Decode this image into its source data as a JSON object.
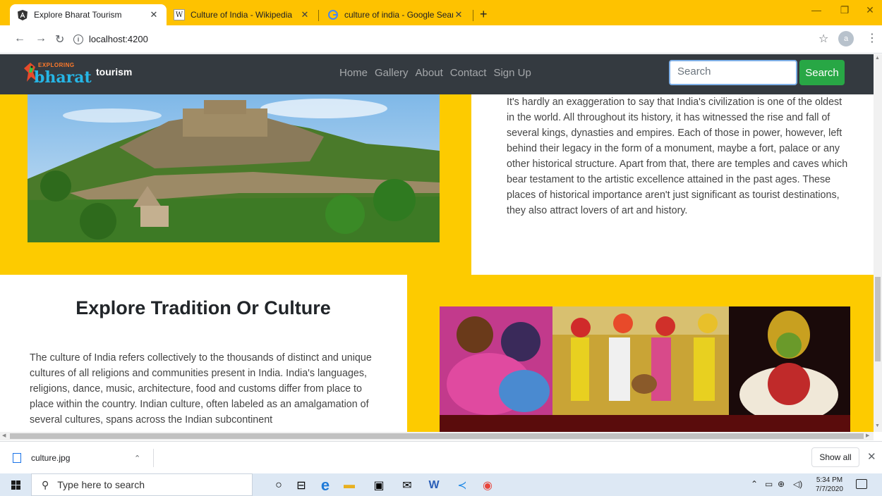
{
  "browser": {
    "tabs": [
      {
        "title": "Explore Bharat Tourism",
        "favicon": "angular-icon",
        "active": true
      },
      {
        "title": "Culture of India - Wikipedia",
        "favicon": "wikipedia-icon",
        "active": false
      },
      {
        "title": "culture of india - Google Search",
        "favicon": "google-icon",
        "active": false
      }
    ],
    "new_tab": "+",
    "url": "localhost:4200",
    "profile_initial": "a",
    "tab_strip_color": "#fec200"
  },
  "site": {
    "logo_small": "EXPLORING",
    "logo_big": "bharat",
    "brand": "tourism",
    "nav": [
      "Home",
      "Gallery",
      "About",
      "Contact",
      "Sign Up"
    ],
    "search_placeholder": "Search",
    "search_button": "Search",
    "colors": {
      "navbar": "#343a40",
      "accent": "#fdcb00",
      "search_button": "#28a745"
    }
  },
  "section1": {
    "image": "kumbhalgarh-fort-photo",
    "text": "It's hardly an exaggeration to say that India's civilization is one of the oldest in the world. All throughout its history, it has witnessed the rise and fall of several kings, dynasties and empires. Each of those in power, however, left behind their legacy in the form of a monument, maybe a fort, palace or any other historical structure. Apart from that, there are temples and caves which bear testament to the artistic excellence attained in the past ages. These places of historical importance aren't just significant as tourist destinations, they also attract lovers of art and history."
  },
  "section2": {
    "heading": "Explore Tradition Or Culture",
    "text": "The culture of India refers collectively to the thousands of distinct and unique cultures of all religions and communities present in India. India's languages, religions, dance, music, architecture, food and customs differ from place to place within the country. Indian culture, often labeled as an amalgamation of several cultures, spans across the Indian subcontinent",
    "image": "indian-culture-collage-photo"
  },
  "downloads": {
    "file": "culture.jpg",
    "show_all": "Show all"
  },
  "taskbar": {
    "search_placeholder": "Type here to search",
    "time": "5:34 PM",
    "date": "7/7/2020"
  }
}
